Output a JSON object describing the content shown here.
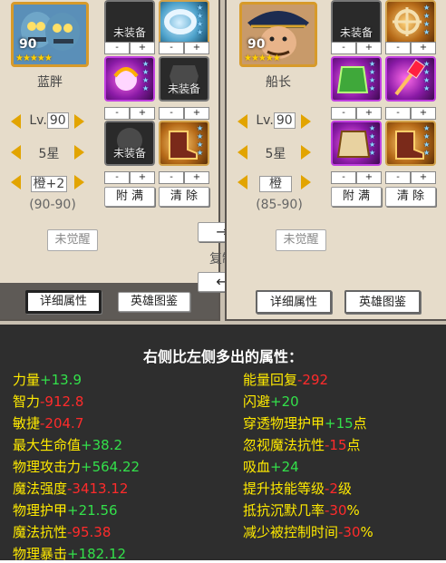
{
  "left_hero": {
    "level_badge": "90",
    "stars": "★★★★★",
    "name": "蓝胖",
    "items": [
      {
        "label": "未装备"
      },
      {
        "label": ""
      },
      {
        "label": ""
      },
      {
        "label": "未装备"
      },
      {
        "label": "未装备"
      },
      {
        "label": ""
      }
    ],
    "lv_label": "Lv.",
    "lv_value": "90",
    "star_value": "5星",
    "rank_value": "橙+2",
    "range": "(90-90)",
    "fill_label": "附 满",
    "clear_label": "清 除",
    "awaken_label": "未觉醒",
    "detail_label": "详细属性",
    "codex_label": "英雄图鉴"
  },
  "right_hero": {
    "level_badge": "90",
    "stars": "★★★★★",
    "name": "船长",
    "items": [
      {
        "label": "未装备"
      },
      {
        "label": ""
      },
      {
        "label": ""
      },
      {
        "label": ""
      },
      {
        "label": ""
      },
      {
        "label": ""
      }
    ],
    "lv_label": "Lv.",
    "lv_value": "90",
    "star_value": "5星",
    "rank_value": "橙",
    "range": "(85-90)",
    "fill_label": "附 满",
    "clear_label": "清 除",
    "awaken_label": "未觉醒",
    "detail_label": "详细属性",
    "codex_label": "英雄图鉴"
  },
  "stepper": {
    "minus": "-",
    "plus": "+"
  },
  "center": {
    "copy_right_arrow": "→",
    "copy_label": "复制",
    "copy_left_arrow": "←"
  },
  "compare": {
    "title": "右侧比左侧多出的属性：",
    "left_stats": [
      {
        "name": "力量",
        "value": "+13.9",
        "unit": "",
        "sign": "pos"
      },
      {
        "name": "智力",
        "value": "-912.8",
        "unit": "",
        "sign": "neg"
      },
      {
        "name": "敏捷",
        "value": "-204.7",
        "unit": "",
        "sign": "neg"
      },
      {
        "name": "最大生命值",
        "value": "+38.2",
        "unit": "",
        "sign": "pos"
      },
      {
        "name": "物理攻击力",
        "value": "+564.22",
        "unit": "",
        "sign": "pos"
      },
      {
        "name": "魔法强度",
        "value": "-3413.12",
        "unit": "",
        "sign": "neg"
      },
      {
        "name": "物理护甲",
        "value": "+21.56",
        "unit": "",
        "sign": "pos"
      },
      {
        "name": "魔法抗性",
        "value": "-95.38",
        "unit": "",
        "sign": "neg"
      },
      {
        "name": "物理暴击",
        "value": "+182.12",
        "unit": "",
        "sign": "pos"
      }
    ],
    "right_stats": [
      {
        "name": "能量回复",
        "value": "-292",
        "unit": "",
        "sign": "neg"
      },
      {
        "name": "闪避",
        "value": "+20",
        "unit": "",
        "sign": "pos"
      },
      {
        "name": "穿透物理护甲",
        "value": "+15",
        "unit": "点",
        "sign": "pos"
      },
      {
        "name": "忽视魔法抗性",
        "value": "-15",
        "unit": "点",
        "sign": "neg"
      },
      {
        "name": "吸血",
        "value": "+24",
        "unit": "",
        "sign": "pos"
      },
      {
        "name": "提升技能等级",
        "value": "-2",
        "unit": "级",
        "sign": "neg"
      },
      {
        "name": "抵抗沉默几率",
        "value": "-30",
        "unit": "%",
        "sign": "neg"
      },
      {
        "name": "减少被控制时间",
        "value": "-30",
        "unit": "%",
        "sign": "neg"
      }
    ]
  },
  "colors": {
    "accent_gold": "#e2a400",
    "positive": "#33e04a",
    "negative": "#ff2b2b",
    "stat_name": "#ffea00",
    "dark_bg": "#2e2e2e"
  }
}
